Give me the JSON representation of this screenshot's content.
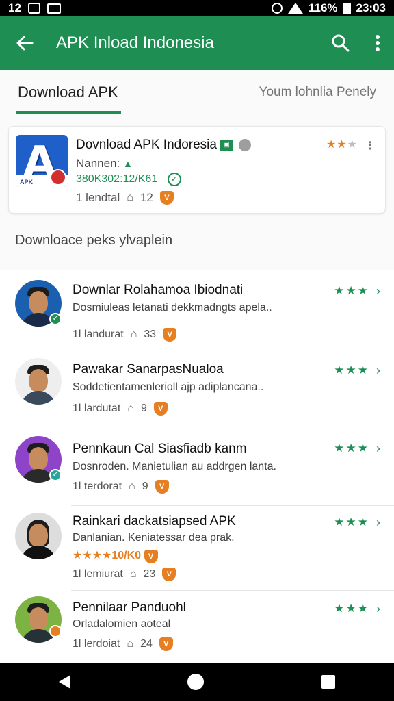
{
  "status_bar": {
    "time_left": "12",
    "battery": "116%",
    "clock": "23:03"
  },
  "app_bar": {
    "title": "APK Inload Indonesia"
  },
  "tabs": {
    "active": "Download APK",
    "inactive": "Youm lohnlia Penely"
  },
  "featured": {
    "title": "Dovnload APK Indoresia",
    "logo_text": "APK",
    "subtitle": "Nannen:",
    "meta": "380K302:12/K61",
    "stats_label": "1 lendtal",
    "stats_count": "12",
    "rating": "★★",
    "rating_dim": "★"
  },
  "section_label": "Downloace peks ylvaplein",
  "items": [
    {
      "title": "Downlar Rolahamoa Ibiodnati",
      "desc": "Dosmiuleas letanati dekkmadngts apela..",
      "stats_label": "1l landurat",
      "stats_count": "33",
      "stars": "★★★"
    },
    {
      "title": "Pawakar SanarpasNualoa",
      "desc": "Soddetientamenlerioll ajp adiplancana..",
      "stats_label": "1l lardutat",
      "stats_count": "9",
      "stars": "★★★"
    },
    {
      "title": "Pennkaun Cal Siasfiadb kanm",
      "desc": "Dosnroden. Manietulian au addrgen lanta.",
      "stats_label": "1l terdorat",
      "stats_count": "9",
      "stars": "★★★"
    },
    {
      "title": "Rainkari dackatsiapsed APK",
      "desc": "★★★★10/K0",
      "desc_line": "Danlanian. Keniatessar dea prak.",
      "stats_label": "1l lemiurat",
      "stats_count": "23",
      "stars": "★★★"
    },
    {
      "title": "Pennilaar Panduohl",
      "desc": "Orladalomien aoteal",
      "stats_label": "1l lerdoiat",
      "stats_count": "24",
      "stars": "★★★"
    }
  ],
  "colors": {
    "brand_green": "#1e8e53",
    "accent_orange": "#e67e22"
  },
  "icons": [
    "back-arrow-icon",
    "search-icon",
    "more-vert-icon",
    "home-icon",
    "shield-icon",
    "check-icon",
    "chevron-right-icon"
  ]
}
